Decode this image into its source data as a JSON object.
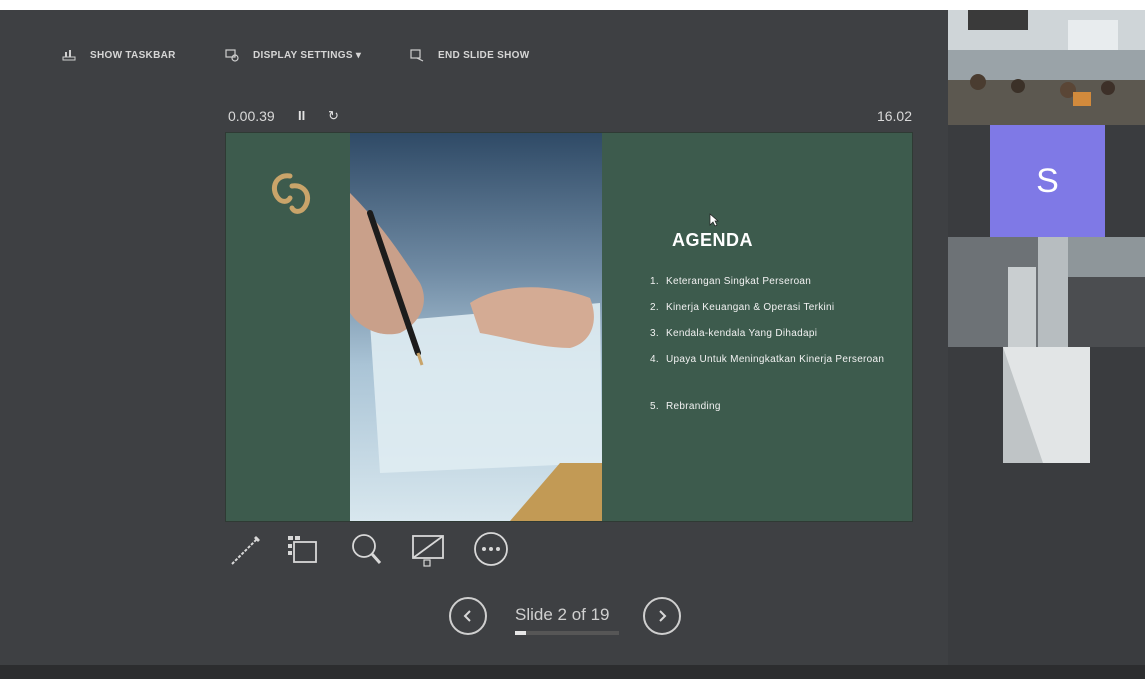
{
  "toolbar": {
    "show_taskbar_label": "SHOW TASKBAR",
    "display_settings_label": "DISPLAY SETTINGS ▾",
    "end_slide_show_label": "END SLIDE SHOW"
  },
  "timer": {
    "elapsed": "0.00.39",
    "pause_glyph": "II",
    "restart_glyph": "↻",
    "clock": "16.02"
  },
  "slide": {
    "title": "AGENDA",
    "items": [
      {
        "num": "1.",
        "text": "Keterangan Singkat Perseroan"
      },
      {
        "num": "2.",
        "text": "Kinerja Keuangan & Operasi Terkini"
      },
      {
        "num": "3.",
        "text": "Kendala-kendala Yang Dihadapi"
      },
      {
        "num": "4.",
        "text": "Upaya Untuk Meningkatkan Kinerja Perseroan"
      },
      {
        "num": "5.",
        "text": "Rebranding"
      }
    ],
    "colors": {
      "background": "#3d5b4d",
      "logo": "#c9a46a"
    }
  },
  "navigation": {
    "slide_counter": "Slide 2 of 19",
    "current_slide": 2,
    "total_slides": 19
  },
  "participants": {
    "avatar_initial": "S",
    "avatar_color": "#7f79e6"
  }
}
